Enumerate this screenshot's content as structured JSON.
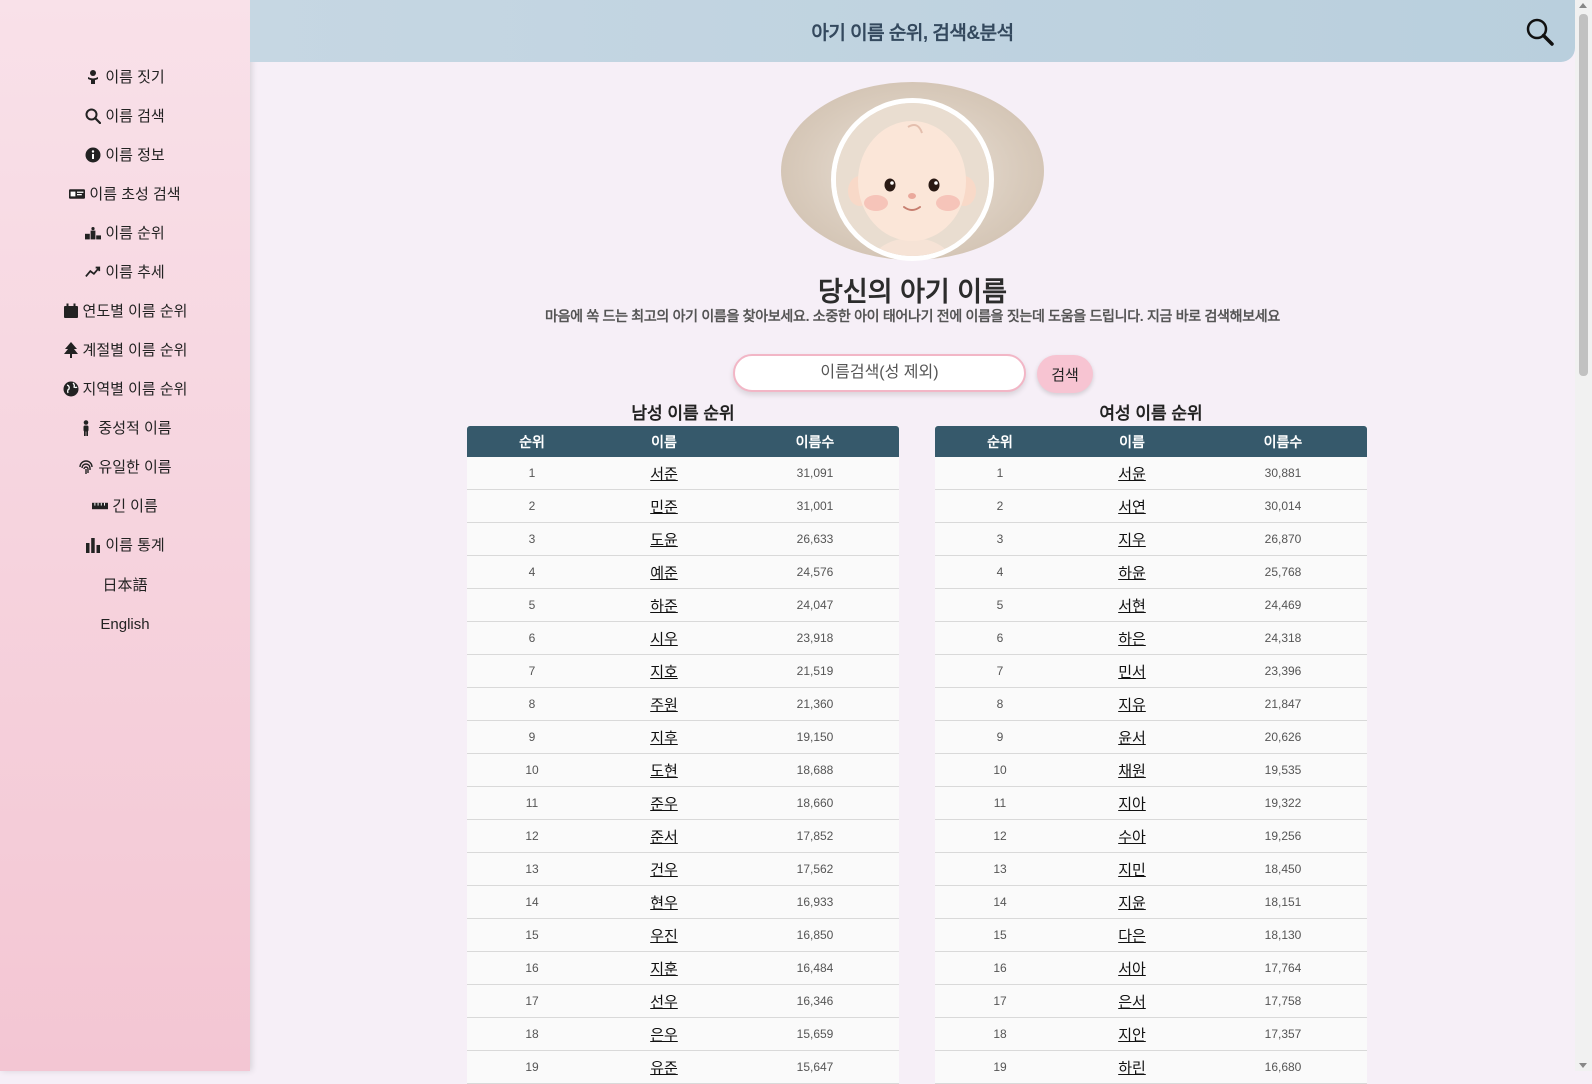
{
  "sidebar": {
    "items": [
      {
        "label": "이름 짓기",
        "icon": "baby-icon"
      },
      {
        "label": "이름 검색",
        "icon": "search-icon"
      },
      {
        "label": "이름 정보",
        "icon": "info-icon"
      },
      {
        "label": "이름 초성 검색",
        "icon": "id-card-icon"
      },
      {
        "label": "이름 순위",
        "icon": "ranking-icon"
      },
      {
        "label": "이름 추세",
        "icon": "trend-icon"
      },
      {
        "label": "연도별 이름 순위",
        "icon": "calendar-icon"
      },
      {
        "label": "계절별 이름 순위",
        "icon": "tree-icon"
      },
      {
        "label": "지역별 이름 순위",
        "icon": "globe-icon"
      },
      {
        "label": "중성적 이름",
        "icon": "person-icon"
      },
      {
        "label": "유일한 이름",
        "icon": "fingerprint-icon"
      },
      {
        "label": "긴 이름",
        "icon": "ruler-icon"
      },
      {
        "label": "이름 통계",
        "icon": "bar-chart-icon"
      }
    ],
    "languages": [
      "日本語",
      "English"
    ]
  },
  "header": {
    "title": "아기 이름 순위, 검색&분석"
  },
  "hero": {
    "title": "당신의 아기 이름",
    "subtitle": "마음에 쏙 드는 최고의 아기 이름을 찾아보세요. 소중한 아이 태어나기 전에 이름을 짓는데 도움을 드립니다. 지금 바로 검색해보세요"
  },
  "search": {
    "placeholder": "이름검색(성 제외)",
    "button": "검색"
  },
  "columns": [
    "순위",
    "이름",
    "이름수"
  ],
  "male": {
    "title": "남성 이름 순위",
    "rows": [
      [
        "1",
        "서준",
        "31,091"
      ],
      [
        "2",
        "민준",
        "31,001"
      ],
      [
        "3",
        "도윤",
        "26,633"
      ],
      [
        "4",
        "예준",
        "24,576"
      ],
      [
        "5",
        "하준",
        "24,047"
      ],
      [
        "6",
        "시우",
        "23,918"
      ],
      [
        "7",
        "지호",
        "21,519"
      ],
      [
        "8",
        "주원",
        "21,360"
      ],
      [
        "9",
        "지후",
        "19,150"
      ],
      [
        "10",
        "도현",
        "18,688"
      ],
      [
        "11",
        "준우",
        "18,660"
      ],
      [
        "12",
        "준서",
        "17,852"
      ],
      [
        "13",
        "건우",
        "17,562"
      ],
      [
        "14",
        "현우",
        "16,933"
      ],
      [
        "15",
        "우진",
        "16,850"
      ],
      [
        "16",
        "지훈",
        "16,484"
      ],
      [
        "17",
        "선우",
        "16,346"
      ],
      [
        "18",
        "은우",
        "15,659"
      ],
      [
        "19",
        "유준",
        "15,647"
      ]
    ]
  },
  "female": {
    "title": "여성 이름 순위",
    "rows": [
      [
        "1",
        "서윤",
        "30,881"
      ],
      [
        "2",
        "서연",
        "30,014"
      ],
      [
        "3",
        "지우",
        "26,870"
      ],
      [
        "4",
        "하윤",
        "25,768"
      ],
      [
        "5",
        "서현",
        "24,469"
      ],
      [
        "6",
        "하은",
        "24,318"
      ],
      [
        "7",
        "민서",
        "23,396"
      ],
      [
        "8",
        "지유",
        "21,847"
      ],
      [
        "9",
        "윤서",
        "20,626"
      ],
      [
        "10",
        "채원",
        "19,535"
      ],
      [
        "11",
        "지아",
        "19,322"
      ],
      [
        "12",
        "수아",
        "19,256"
      ],
      [
        "13",
        "지민",
        "18,450"
      ],
      [
        "14",
        "지윤",
        "18,151"
      ],
      [
        "15",
        "다은",
        "18,130"
      ],
      [
        "16",
        "서아",
        "17,764"
      ],
      [
        "17",
        "은서",
        "17,758"
      ],
      [
        "18",
        "지안",
        "17,357"
      ],
      [
        "19",
        "하린",
        "16,680"
      ]
    ]
  }
}
